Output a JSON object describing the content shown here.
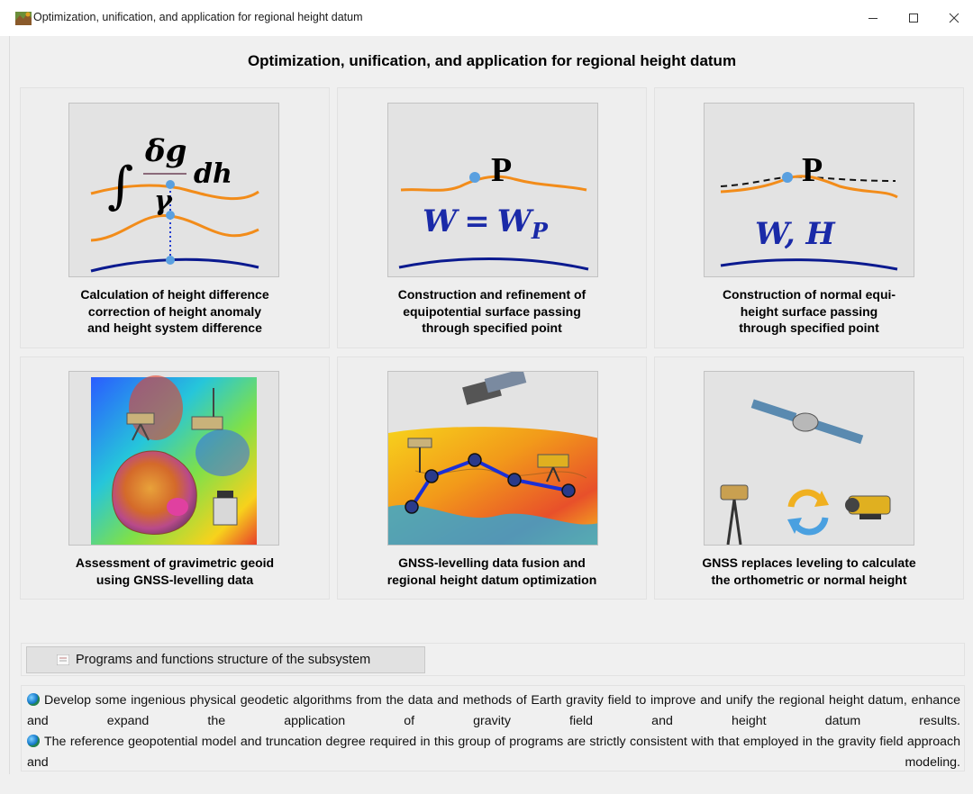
{
  "window": {
    "title": "Optimization, unification, and application for regional height datum",
    "controls": [
      "minimize-icon",
      "maximize-icon",
      "close-icon"
    ]
  },
  "heading": "Optimization, unification, and application for regional height datum",
  "cards": [
    {
      "caption": [
        "Calculation of height difference",
        "correction of height anomaly",
        "and height system difference"
      ],
      "formula": {
        "numerator": "δg",
        "denominator": "γ",
        "differential": "dh"
      }
    },
    {
      "caption": [
        "Construction and refinement of",
        "equipotential surface passing",
        "through specified point"
      ],
      "point": "P",
      "formula": {
        "lhs": "W",
        "rhs": "W",
        "subscript": "P"
      }
    },
    {
      "caption": [
        "Construction of normal equi-",
        "height surface passing",
        "through specified point"
      ],
      "point": "P",
      "formula": {
        "text": "W, H"
      }
    },
    {
      "caption": [
        "Assessment of gravimetric geoid",
        "using GNSS-levelling data"
      ]
    },
    {
      "caption": [
        "GNSS-levelling data fusion and",
        "regional height datum optimization"
      ]
    },
    {
      "caption": [
        "GNSS replaces leveling to calculate",
        "the orthometric or normal height"
      ]
    }
  ],
  "programs_button": "Programs and functions structure of the subsystem",
  "description": [
    "Develop some ingenious physical geodetic algorithms from the data and methods of Earth gravity field to improve and unify the regional height datum, enhance and expand the application of gravity field and height datum results.",
    "The reference geopotential model and truncation degree required in this group of programs are strictly consistent with that employed in the gravity field approach and modeling."
  ]
}
